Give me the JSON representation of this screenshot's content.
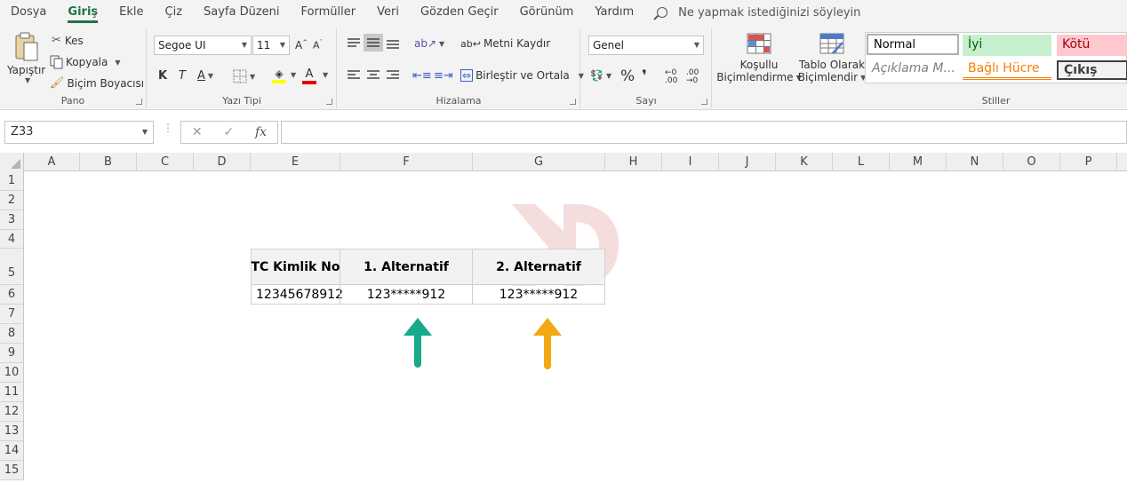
{
  "menu": {
    "items": [
      "Dosya",
      "Giriş",
      "Ekle",
      "Çiz",
      "Sayfa Düzeni",
      "Formüller",
      "Veri",
      "Gözden Geçir",
      "Görünüm",
      "Yardım"
    ],
    "active": "Giriş",
    "tell_me": "Ne yapmak istediğinizi söyleyin"
  },
  "ribbon": {
    "clipboard": {
      "paste": "Yapıştır",
      "cut": "Kes",
      "copy": "Kopyala",
      "format_painter": "Biçim Boyacısı",
      "label": "Pano"
    },
    "font": {
      "name": "Segoe UI",
      "size": "11",
      "bold": "K",
      "italic": "T",
      "underline": "A",
      "label": "Yazı Tipi"
    },
    "alignment": {
      "wrap_text": "Metni Kaydır",
      "merge_center": "Birleştir ve Ortala",
      "label": "Hizalama"
    },
    "number": {
      "format": "Genel",
      "percent": "%",
      "comma": "❜",
      "label": "Sayı"
    },
    "styles": {
      "conditional_line1": "Koşullu",
      "conditional_line2": "Biçimlendirme",
      "table_line1": "Tablo Olarak",
      "table_line2": "Biçimlendir",
      "normal": "Normal",
      "good": "İyi",
      "bad": "Kötü",
      "explanatory": "Açıklama M...",
      "linked_cell": "Bağlı Hücre",
      "output": "Çıkış",
      "label": "Stiller"
    }
  },
  "formula_bar": {
    "name_box": "Z33",
    "cancel": "✕",
    "enter": "✓",
    "fx": "fx",
    "value": ""
  },
  "columns": [
    "A",
    "B",
    "C",
    "D",
    "E",
    "F",
    "G",
    "H",
    "I",
    "J",
    "K",
    "L",
    "M",
    "N",
    "O",
    "P"
  ],
  "rows": [
    "1",
    "2",
    "3",
    "4",
    "5",
    "6",
    "7",
    "8",
    "9",
    "10",
    "11",
    "12",
    "13",
    "14",
    "15"
  ],
  "table": {
    "headers": [
      "TC Kimlik No",
      "1. Alternatif",
      "2. Alternatif"
    ],
    "values": [
      "12345678912",
      "123*****912",
      "123*****912"
    ]
  },
  "colors": {
    "accent": "#217346",
    "arrow_green": "#16a98a",
    "arrow_orange": "#f3a712",
    "watermark": "#e8b4b4"
  }
}
